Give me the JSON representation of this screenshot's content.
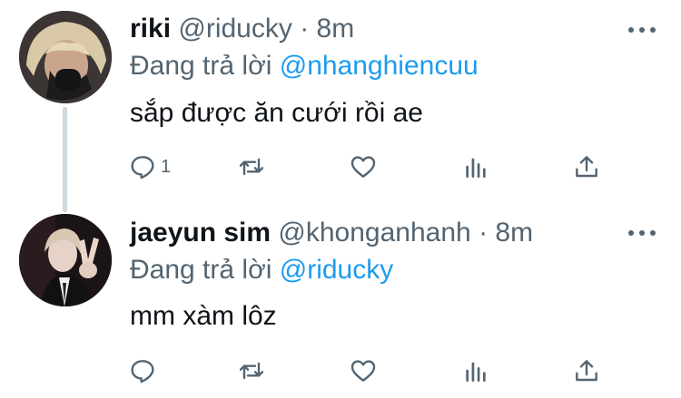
{
  "tweets": [
    {
      "display_name": "riki",
      "handle": "@riducky",
      "separator": "·",
      "time": "8m",
      "reply_prefix": "Đang trả lời",
      "reply_mention": "@nhanghiencuu",
      "text": "sắp được ăn cưới rồi ae",
      "reply_count": "1",
      "retweet_count": "",
      "like_count": ""
    },
    {
      "display_name": "jaeyun sim",
      "handle": "@khonganhanh",
      "separator": "·",
      "time": "8m",
      "reply_prefix": "Đang trả lời",
      "reply_mention": "@riducky",
      "text": "mm xàm lôz",
      "reply_count": "",
      "retweet_count": "",
      "like_count": ""
    }
  ],
  "colors": {
    "text": "#0f1419",
    "secondary": "#536471",
    "link": "#1d9bf0",
    "thread_line": "#cfd9de"
  },
  "icons": [
    "reply-icon",
    "retweet-icon",
    "like-icon",
    "stats-icon",
    "share-icon",
    "more-icon"
  ]
}
